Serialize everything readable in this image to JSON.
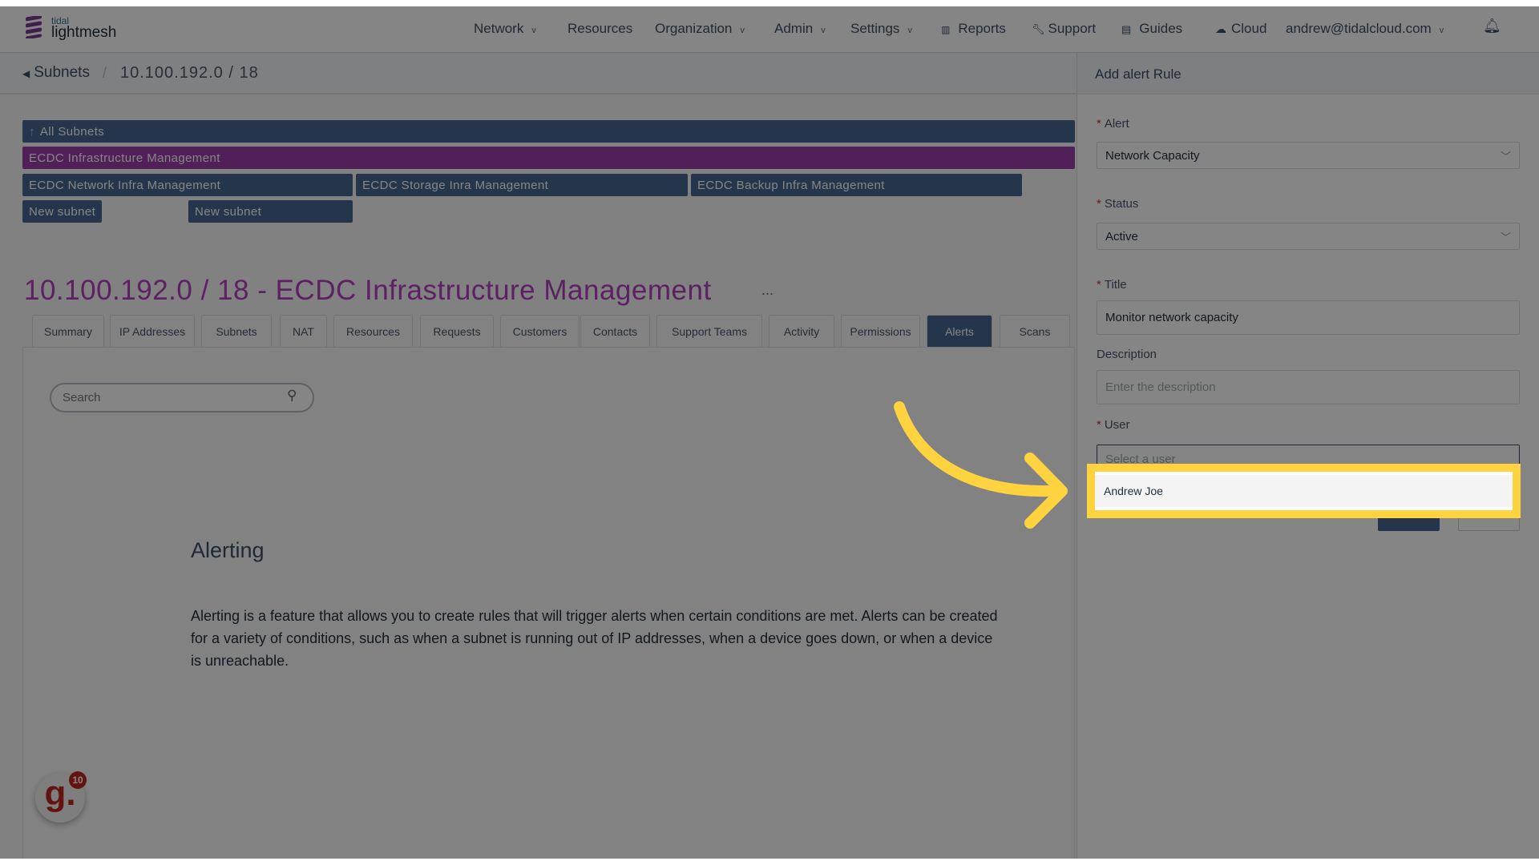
{
  "header": {
    "logo_top": "tidal",
    "logo_bottom": "lightmesh",
    "nav": [
      {
        "label": "Network",
        "chevron": true
      },
      {
        "label": "Resources",
        "chevron": false
      },
      {
        "label": "Organization",
        "chevron": true
      },
      {
        "label": "Admin",
        "chevron": true
      },
      {
        "label": "Settings",
        "chevron": true
      },
      {
        "label": "Reports",
        "icon": "bar-chart-icon"
      },
      {
        "label": "Support",
        "icon": "wrench-icon"
      },
      {
        "label": "Guides",
        "icon": "book-icon"
      },
      {
        "label": "Cloud",
        "icon": "cloud-icon"
      }
    ],
    "user": "andrew@tidalcloud.com",
    "bell_icon": "bell-icon"
  },
  "breadcrumb": {
    "back": "Subnets",
    "separator": "/",
    "current": "10.100.192.0 / 18"
  },
  "subnets": {
    "all": "All Subnets",
    "parent": "ECDC Infrastructure Management",
    "children": [
      "ECDC Network Infra Management",
      "ECDC Storage Inra Management",
      "ECDC Backup Infra Management"
    ],
    "new": [
      "New subnet",
      "New subnet"
    ]
  },
  "page": {
    "title": "10.100.192.0 / 18 - ECDC Infrastructure Management",
    "more": "...",
    "tabs": [
      "Summary",
      "IP Addresses",
      "Subnets",
      "NAT",
      "Resources",
      "Requests",
      "Customers",
      "Contacts",
      "Support Teams",
      "Activity",
      "Permissions",
      "Alerts",
      "Scans"
    ],
    "active_tab": "Alerts",
    "search_placeholder": "Search",
    "alerting_heading": "Alerting",
    "alerting_text": "Alerting is a feature that allows you to create rules that will trigger alerts when certain conditions are met. Alerts can be created for a variety of conditions, such as when a subnet is running out of IP addresses, when a device goes down, or when a device is unreachable."
  },
  "panel": {
    "title": "Add alert Rule",
    "alert_label": "Alert",
    "alert_value": "Network Capacity",
    "status_label": "Status",
    "status_value": "Active",
    "title_label": "Title",
    "title_value": "Monitor network capacity",
    "description_label": "Description",
    "description_placeholder": "Enter the description",
    "user_label": "User",
    "user_placeholder": "Select a user",
    "user_options": [
      "Andrew Joe"
    ],
    "required_mark": "*"
  },
  "widget": {
    "letter": "g.",
    "badge": "10"
  },
  "colors": {
    "accent_navy": "#476992",
    "accent_purple": "#9d3ea9",
    "highlight": "#ffd23f"
  }
}
